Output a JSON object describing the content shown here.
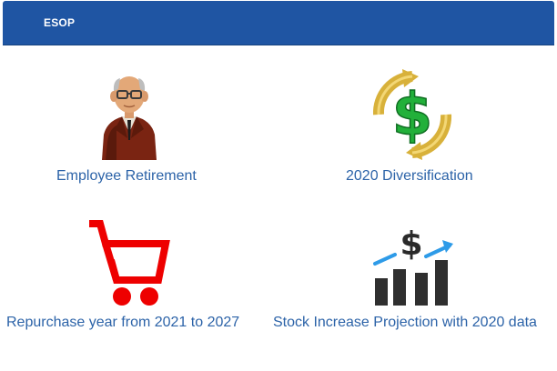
{
  "header": {
    "title": "ESOP",
    "background_color": "#1f55a3"
  },
  "tiles": [
    {
      "label": "Employee Retirement",
      "icon": "retiree-man-icon"
    },
    {
      "label": "2020 Diversification",
      "icon": "dollar-cycle-icon"
    },
    {
      "label": "Repurchase year from 2021 to 2027",
      "icon": "shopping-cart-icon"
    },
    {
      "label": "Stock Increase Projection with 2020 data",
      "icon": "stock-growth-chart-icon"
    }
  ],
  "colors": {
    "label": "#2c63a8",
    "cart_red": "#ee0000",
    "dollar_green": "#22b03a",
    "arrows_gold": "#d8b13a",
    "chart_bars": "#2f2f2f",
    "chart_arrow_blue": "#2e9be8"
  }
}
